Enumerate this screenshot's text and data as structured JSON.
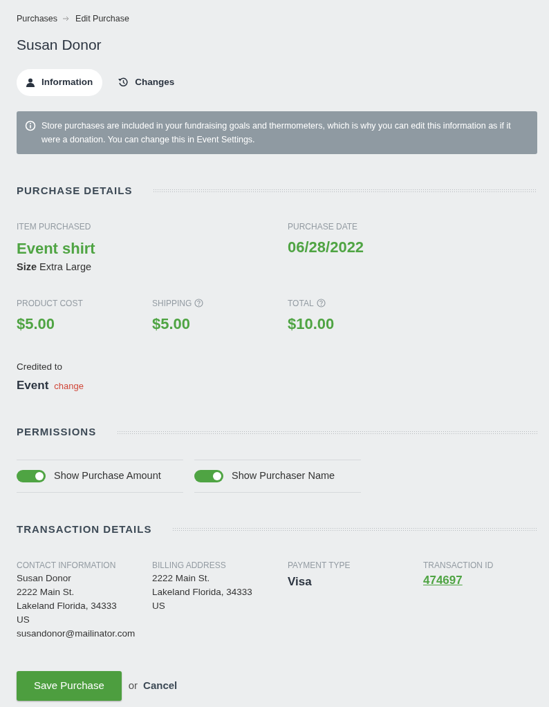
{
  "breadcrumb": [
    {
      "label": "Purchases"
    },
    {
      "label": "Edit Purchase"
    }
  ],
  "title": "Susan Donor",
  "tabs": [
    {
      "label": "Information",
      "selected": true
    },
    {
      "label": "Changes",
      "selected": false
    }
  ],
  "notice": "Store purchases are included in your fundraising goals and thermometers, which is why you can edit this information as if it were a donation. You can change this in Event Settings.",
  "purchase_details": {
    "title": "PURCHASE DETAILS",
    "item": {
      "label": "ITEM PURCHASED",
      "name": "Event shirt",
      "size_label": "Size",
      "size_value": "Extra Large"
    },
    "date": {
      "label": "PURCHASE DATE",
      "value": "06/28/2022"
    },
    "costs": [
      {
        "label": "PRODUCT COST",
        "value": "$5.00",
        "help": false
      },
      {
        "label": "SHIPPING",
        "value": "$5.00",
        "help": true
      },
      {
        "label": "TOTAL",
        "value": "$10.00",
        "help": true
      }
    ],
    "credited": {
      "label": "Credited to",
      "value": "Event",
      "link": "change"
    }
  },
  "permissions": {
    "title": "PERMISSIONS",
    "toggles": [
      {
        "label": "Show Purchase Amount",
        "on": true
      },
      {
        "label": "Show Purchaser Name",
        "on": true
      }
    ]
  },
  "transaction_details": {
    "title": "TRANSACTION DETAILS",
    "columns": [
      {
        "kind": "lines",
        "label": "CONTACT INFORMATION",
        "lines": [
          "Susan Donor",
          "2222 Main St.",
          "Lakeland Florida, 34333",
          "US",
          "susandonor@mailinator.com"
        ]
      },
      {
        "kind": "lines",
        "label": "BILLING ADDRESS",
        "lines": [
          "2222 Main St.",
          "Lakeland Florida, 34333",
          "US"
        ]
      },
      {
        "kind": "value",
        "label": "PAYMENT TYPE",
        "value": "Visa"
      },
      {
        "kind": "link",
        "label": "TRANSACTION ID",
        "value": "474697"
      }
    ]
  },
  "actions": {
    "save": "Save Purchase",
    "or": "or",
    "cancel": "Cancel"
  }
}
